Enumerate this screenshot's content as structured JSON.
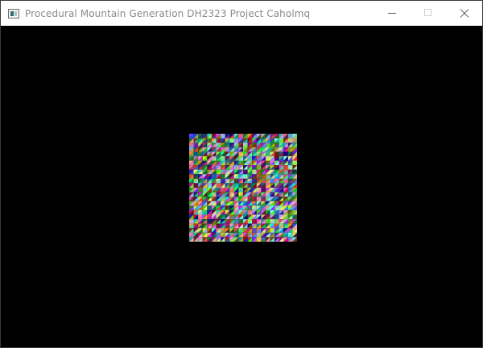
{
  "window": {
    "title": "Procedural Mountain Generation DH2323 Project Caholmq",
    "icon": "app-window-icon",
    "controls": {
      "minimize": "minimize-icon",
      "maximize": "maximize-icon",
      "close": "close-icon"
    }
  },
  "scene": {
    "background": "#000000",
    "mesh": {
      "style": "random-colored-triangles",
      "grid_cells": 24
    }
  }
}
